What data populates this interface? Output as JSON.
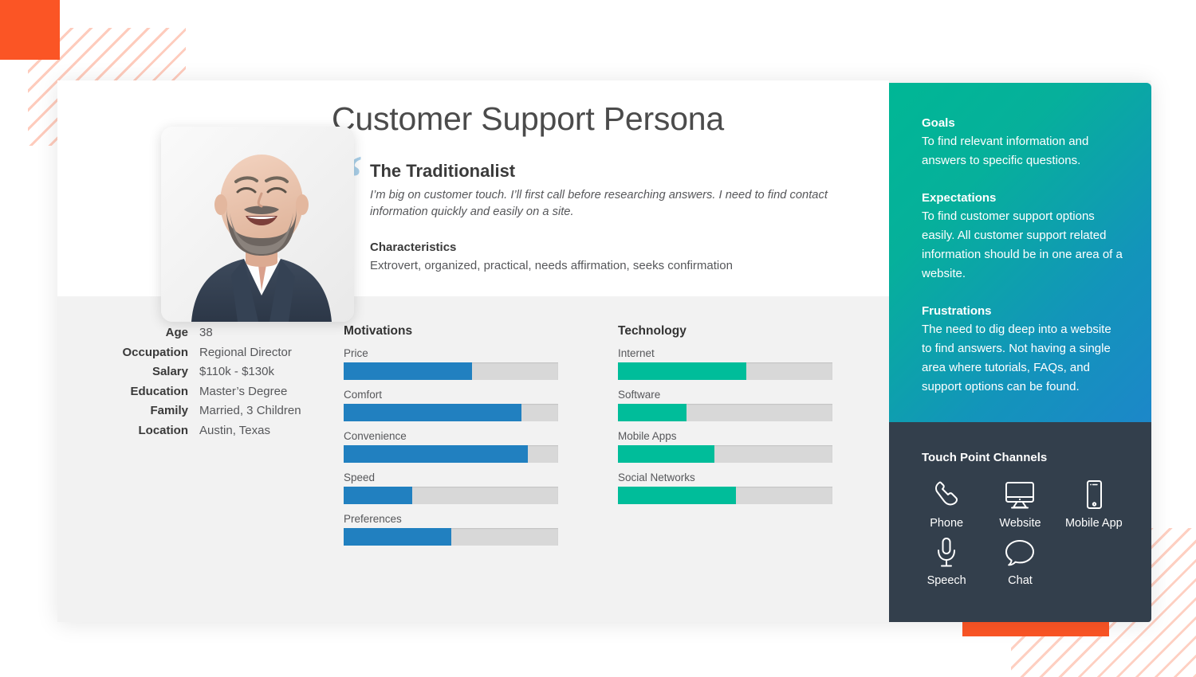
{
  "decor": {
    "orange": "#fb5525",
    "stripe_color": "#fb5525"
  },
  "header": {
    "title": "Customer Support Persona",
    "quote_glyph": "“",
    "persona_name": "The Traditionalist",
    "quote": "I’m big on customer touch. I’ll first call before researching answers. I need to find contact information quickly and easily on a site.",
    "characteristics_label": "Characteristics",
    "characteristics": "Extrovert, organized, practical, needs affirmation, seeks confirmation"
  },
  "avatar": {
    "alt": "smiling bearded man in navy suit"
  },
  "attributes": [
    {
      "label": "Age",
      "value": "38"
    },
    {
      "label": "Occupation",
      "value": "Regional Director"
    },
    {
      "label": "Salary",
      "value": "$110k - $130k"
    },
    {
      "label": "Education",
      "value": "Master’s Degree"
    },
    {
      "label": "Family",
      "value": "Married, 3 Children"
    },
    {
      "label": "Location",
      "value": "Austin, Texas"
    }
  ],
  "chart_data": [
    {
      "type": "bar",
      "title": "Motivations",
      "orientation": "horizontal",
      "color": "#2180c0",
      "track_color": "#d8d8d8",
      "categories": [
        "Price",
        "Comfort",
        "Convenience",
        "Speed",
        "Preferences"
      ],
      "values": [
        60,
        83,
        86,
        32,
        50
      ],
      "xlabel": "",
      "ylabel": "",
      "ylim": [
        0,
        100
      ],
      "grid": false,
      "legend": false
    },
    {
      "type": "bar",
      "title": "Technology",
      "orientation": "horizontal",
      "color": "#00bd9a",
      "track_color": "#d8d8d8",
      "categories": [
        "Internet",
        "Software",
        "Mobile Apps",
        "Social Networks"
      ],
      "values": [
        60,
        32,
        45,
        55
      ],
      "xlabel": "",
      "ylabel": "",
      "ylim": [
        0,
        100
      ],
      "grid": false,
      "legend": false
    }
  ],
  "side_panel": {
    "gradient_from": "#00b795",
    "gradient_to": "#1c87c9",
    "sections": [
      {
        "heading": "Goals",
        "body": "To find relevant information and answers to specific questions."
      },
      {
        "heading": "Expectations",
        "body": "To find customer support options easily. All customer support related information should be in one area of a website."
      },
      {
        "heading": "Frustrations",
        "body": "The need to dig deep into a website to find answers. Not having a single area where tutorials, FAQs, and support options can be found."
      }
    ]
  },
  "touch_points": {
    "title": "Touch Point Channels",
    "background": "#333f4c",
    "items": [
      {
        "label": "Phone",
        "icon": "phone-icon"
      },
      {
        "label": "Website",
        "icon": "monitor-icon"
      },
      {
        "label": "Mobile App",
        "icon": "smartphone-icon"
      },
      {
        "label": "Speech",
        "icon": "microphone-icon"
      },
      {
        "label": "Chat",
        "icon": "chat-bubble-icon"
      }
    ]
  }
}
